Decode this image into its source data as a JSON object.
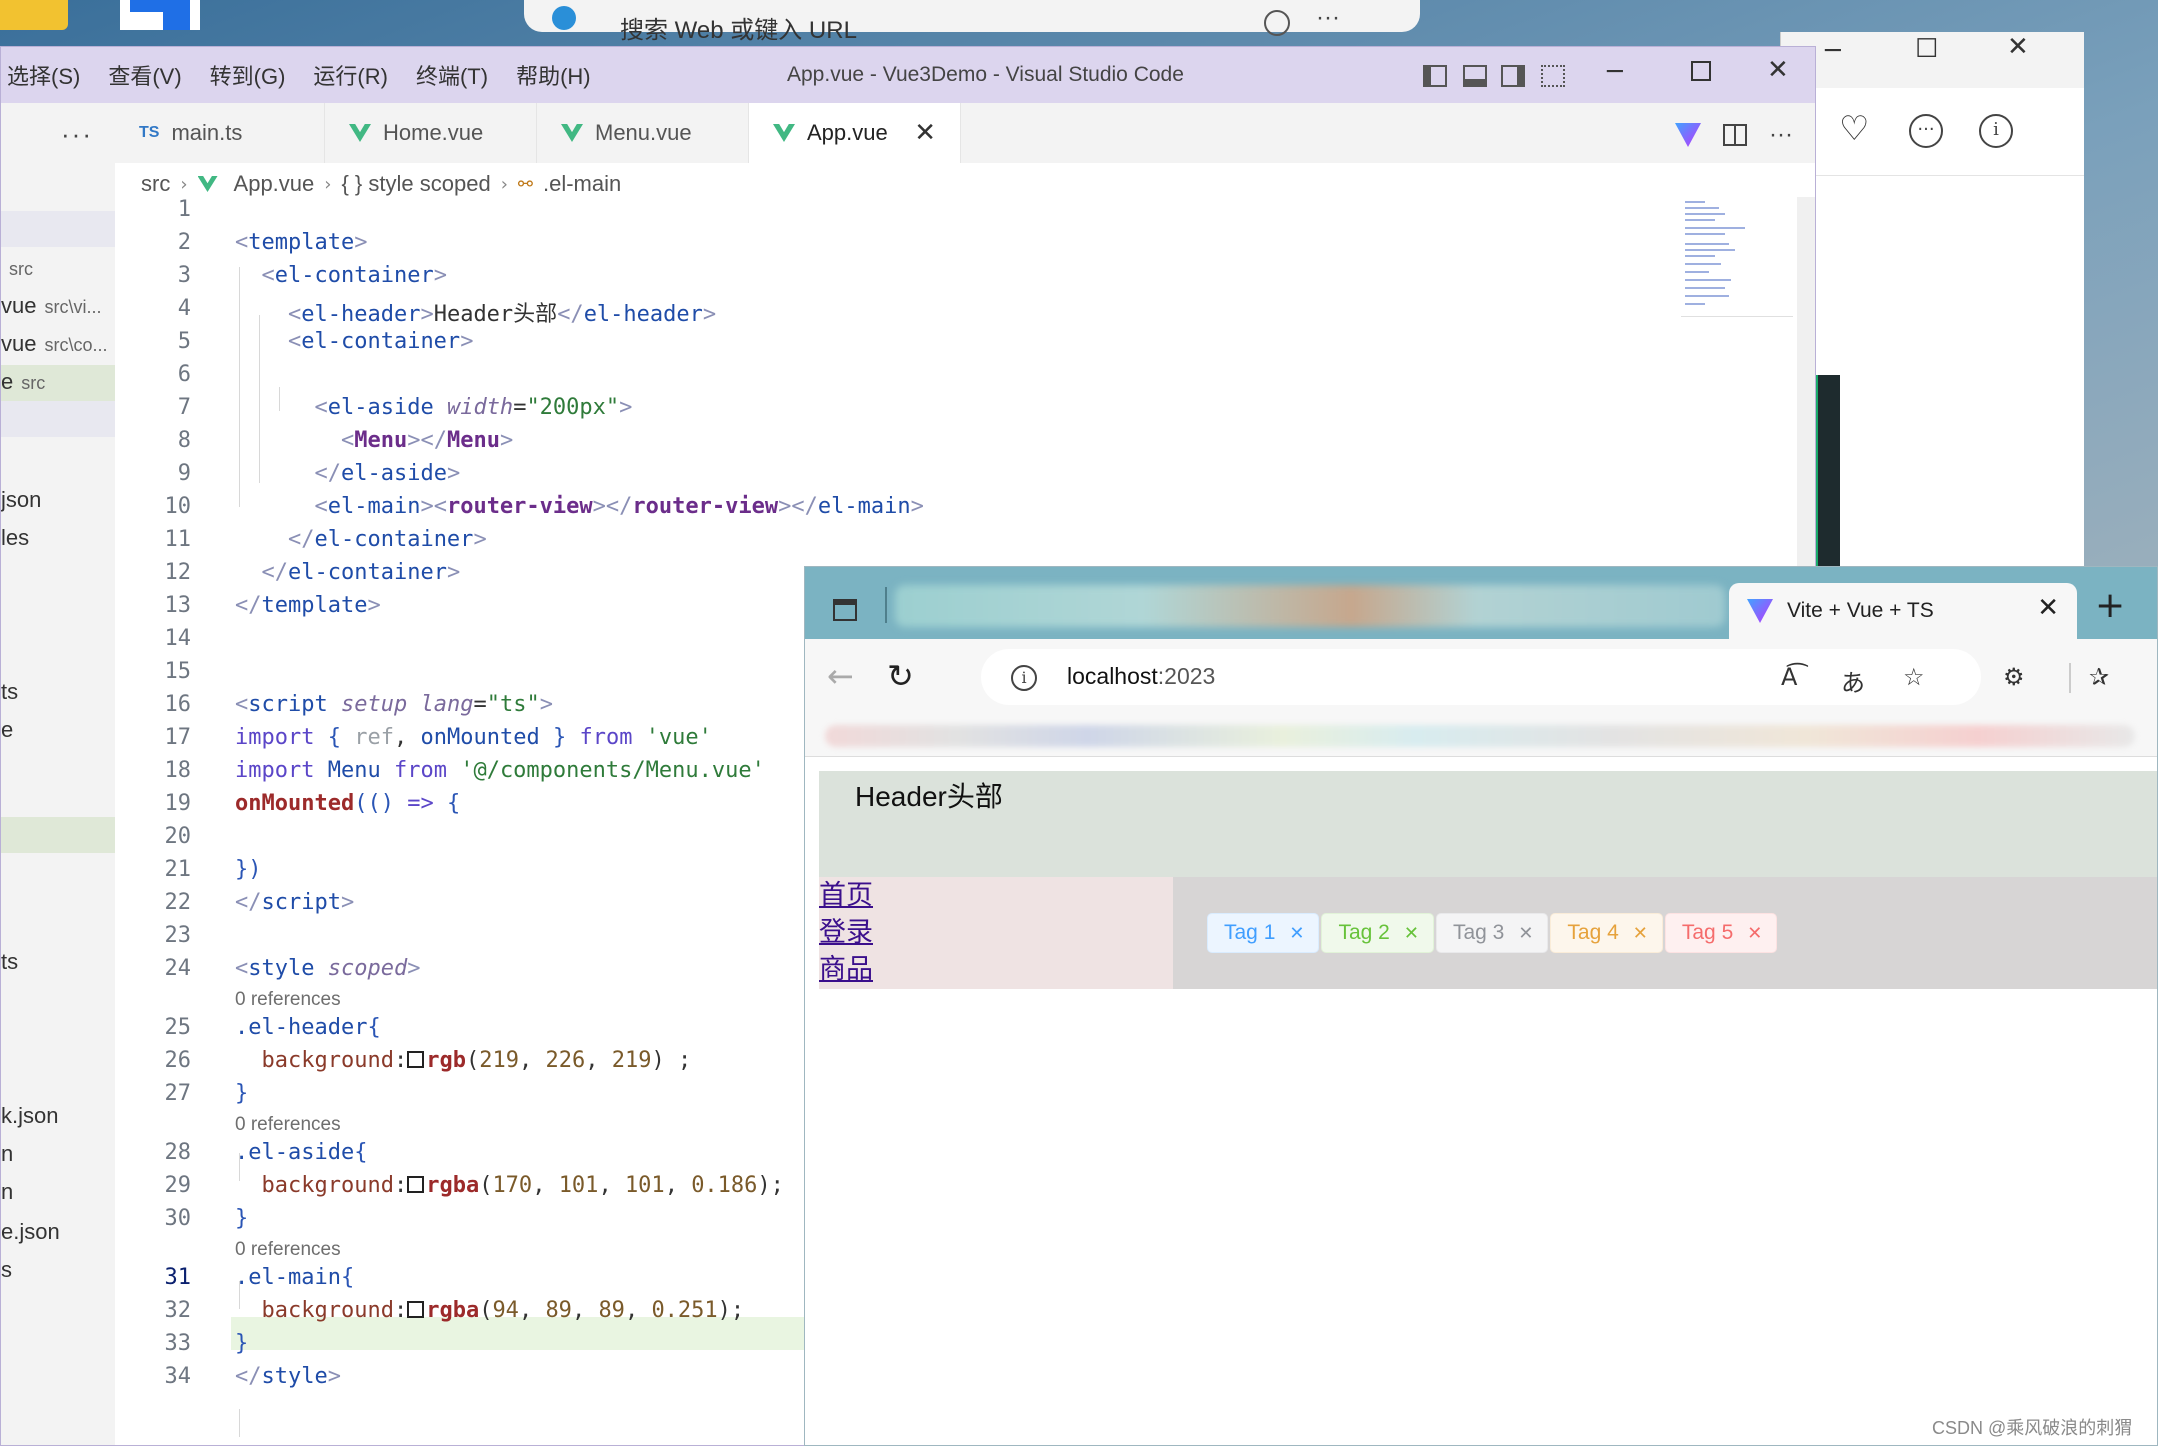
{
  "desktop": {
    "background_browser": {
      "search_placeholder": "搜索 Web 或键入 URL"
    }
  },
  "vscode": {
    "title": "App.vue - Vue3Demo - Visual Studio Code",
    "menu": [
      "选择(S)",
      "查看(V)",
      "转到(G)",
      "运行(R)",
      "终端(T)",
      "帮助(H)"
    ],
    "sidebar": {
      "more_label": "···",
      "items": [
        {
          "label": "",
          "detail": "src"
        },
        {
          "label": "vue",
          "detail": "src\\vi..."
        },
        {
          "label": "vue",
          "detail": "src\\co..."
        },
        {
          "label": "e",
          "detail": "src"
        },
        {
          "label": "json",
          "detail": ""
        },
        {
          "label": "les",
          "detail": ""
        },
        {
          "label": "ts",
          "detail": ""
        },
        {
          "label": "e",
          "detail": ""
        },
        {
          "label": "ts",
          "detail": ""
        },
        {
          "label": "k.json",
          "detail": ""
        },
        {
          "label": "n",
          "detail": ""
        },
        {
          "label": "n",
          "detail": ""
        },
        {
          "label": "e.json",
          "detail": ""
        },
        {
          "label": "s",
          "detail": ""
        }
      ]
    },
    "tabs": [
      {
        "label": "main.ts",
        "icon": "ts-icon",
        "badge": "TS"
      },
      {
        "label": "Home.vue",
        "icon": "vue-icon"
      },
      {
        "label": "Menu.vue",
        "icon": "vue-icon"
      },
      {
        "label": "App.vue",
        "icon": "vue-icon",
        "active": true
      }
    ],
    "breadcrumb": [
      "src",
      "App.vue",
      "{ } style scoped",
      ".el-main"
    ],
    "codelens_label": "0 references",
    "current_line": 31,
    "line_numbers": [
      "1",
      "2",
      "3",
      "4",
      "5",
      "6",
      "7",
      "8",
      "9",
      "10",
      "11",
      "12",
      "13",
      "14",
      "15",
      "16",
      "17",
      "18",
      "19",
      "20",
      "21",
      "22",
      "23",
      "24",
      "25",
      "26",
      "27",
      "28",
      "29",
      "30",
      "31",
      "32",
      "33",
      "34"
    ]
  },
  "browser": {
    "tab_title": "Vite + Vue + TS",
    "url_host": "localhost",
    "url_port": ":2023",
    "page": {
      "header_text": "Header头部",
      "menu_links": [
        "首页",
        "登录",
        "商品"
      ],
      "tags": [
        {
          "label": "Tag 1",
          "type": "primary"
        },
        {
          "label": "Tag 2",
          "type": "success"
        },
        {
          "label": "Tag 3",
          "type": "info"
        },
        {
          "label": "Tag 4",
          "type": "warning"
        },
        {
          "label": "Tag 5",
          "type": "danger"
        }
      ]
    }
  },
  "colors": {
    "vscode_titlebar": "#dcd5ee",
    "edge_tabbar": "#7bb3c2",
    "el_header_bg": "rgb(219, 226, 219)",
    "el_aside_bg": "rgba(170, 101, 101, 0.186)",
    "el_main_bg": "rgba(94, 89, 89, 0.251)"
  },
  "watermark": "CSDN @乘风破浪的刺猬"
}
